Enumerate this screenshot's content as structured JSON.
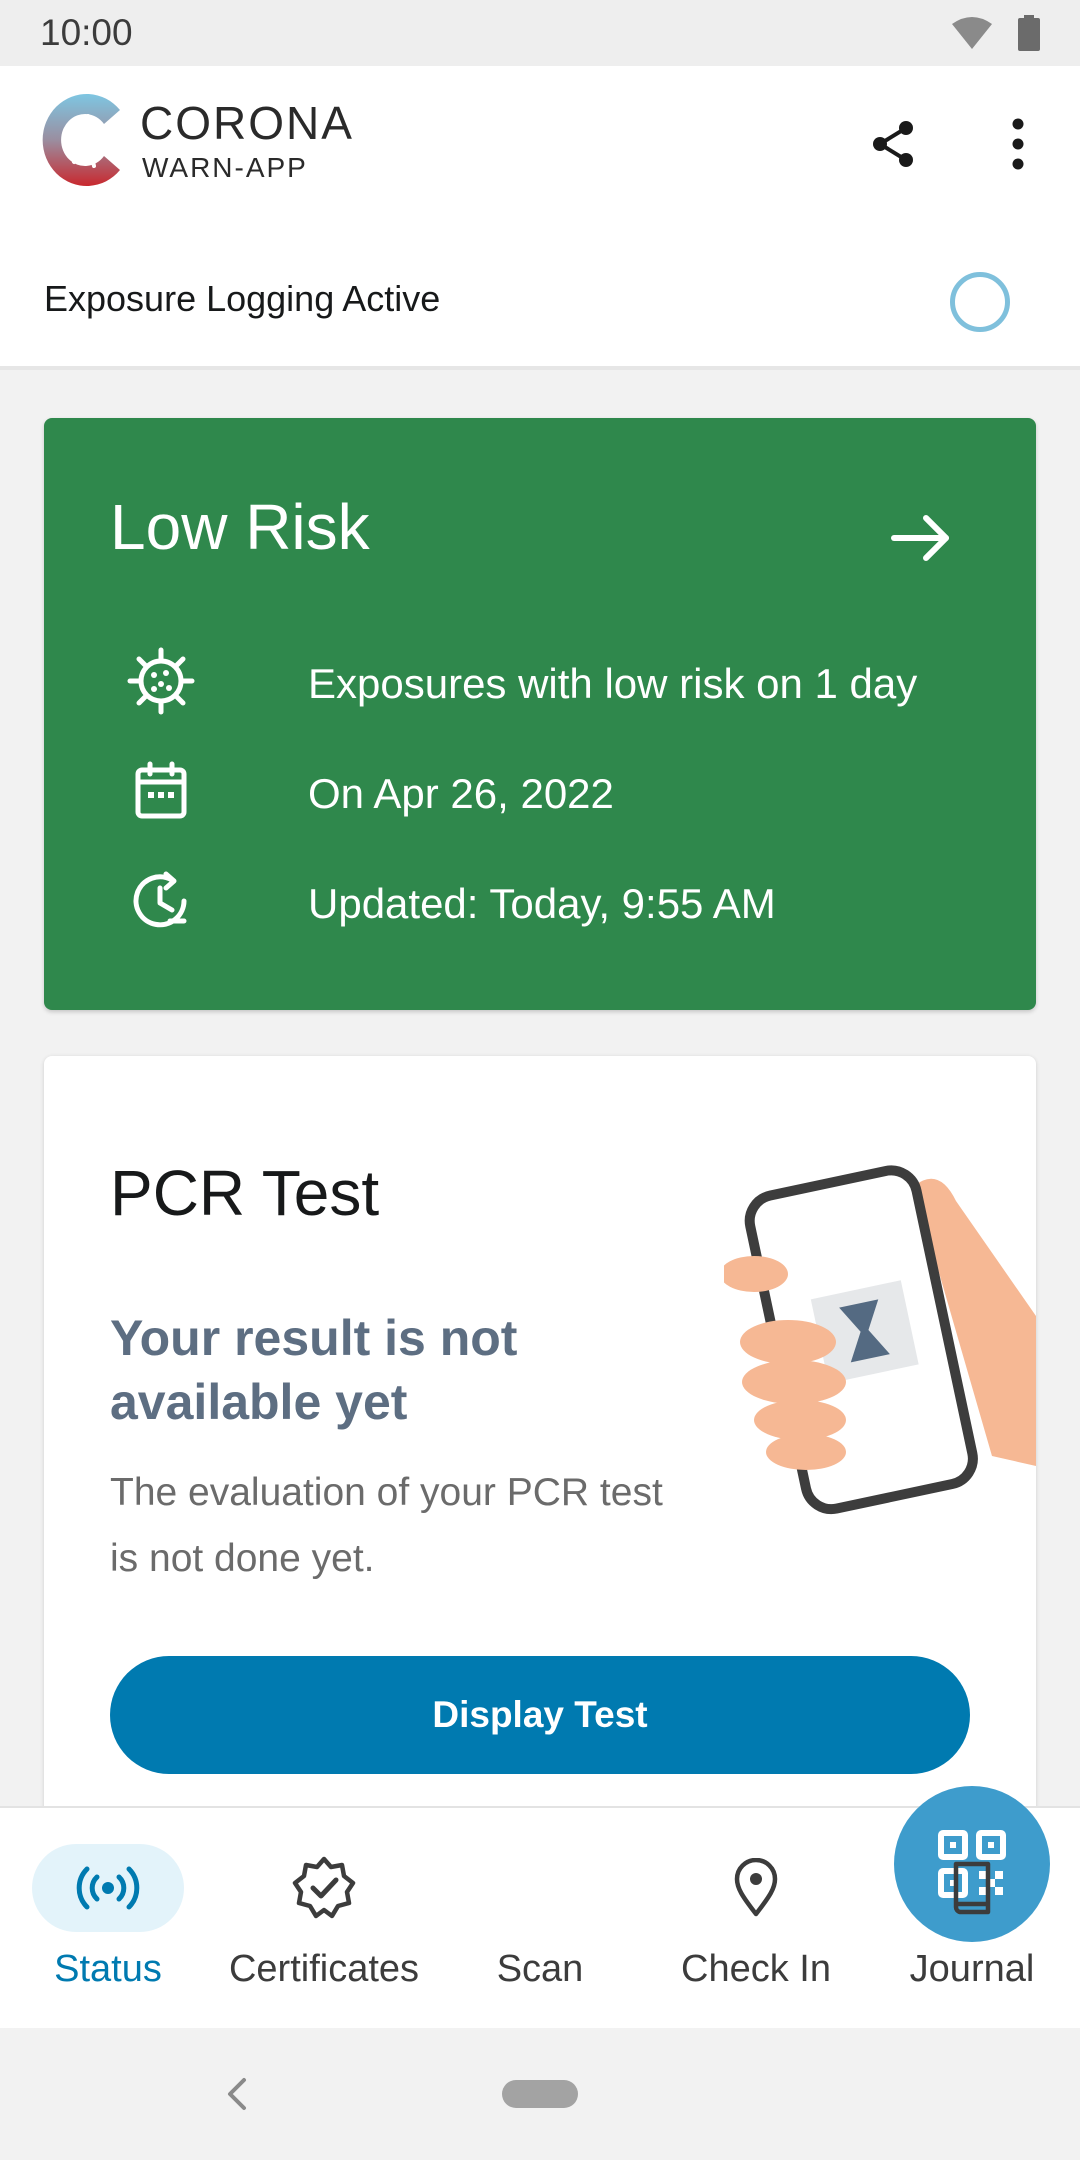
{
  "status_bar": {
    "time": "10:00"
  },
  "header": {
    "brand_title": "CORONA",
    "brand_subtitle": "WARN-APP",
    "icons": [
      "corona-warn-logo",
      "share-icon",
      "more-vert-icon"
    ]
  },
  "exposure": {
    "label": "Exposure Logging Active",
    "ring_color": "#7fc0dc"
  },
  "risk_card": {
    "title": "Low Risk",
    "color": "#2f884c",
    "lines": [
      {
        "icon": "virus-icon",
        "text": "Exposures with low risk on 1 day"
      },
      {
        "icon": "calendar-icon",
        "text": "On Apr 26, 2022"
      },
      {
        "icon": "clock-refresh-icon",
        "text": "Updated: Today, 9:55 AM"
      }
    ]
  },
  "test_card": {
    "title": "PCR Test",
    "subtitle": "Your result is not available yet",
    "body": "The evaluation of your PCR test is not done yet.",
    "button_label": "Display Test",
    "button_color": "#007ab0"
  },
  "bottom_nav": {
    "items": [
      {
        "label": "Status",
        "icon": "broadcast-icon",
        "active": true
      },
      {
        "label": "Certificates",
        "icon": "badge-check-icon",
        "active": false
      },
      {
        "label": "Scan",
        "icon": "qr-code-icon",
        "active": false
      },
      {
        "label": "Check In",
        "icon": "location-pin-icon",
        "active": false
      },
      {
        "label": "Journal",
        "icon": "book-icon",
        "active": false
      }
    ],
    "accent": "#007ab0",
    "fab_color": "#3e9ccc"
  }
}
